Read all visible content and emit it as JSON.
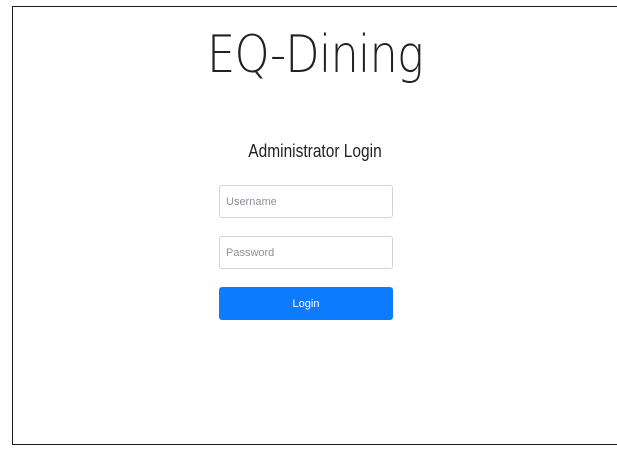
{
  "header": {
    "brand_title": "EQ-Dining",
    "page_subtitle": "Administrator Login"
  },
  "login_form": {
    "username": {
      "value": "",
      "placeholder": "Username"
    },
    "password": {
      "value": "",
      "placeholder": "Password"
    },
    "submit_label": "Login"
  },
  "colors": {
    "accent": "#0d7bfd",
    "text": "#222222",
    "input_border": "#ced4da"
  }
}
